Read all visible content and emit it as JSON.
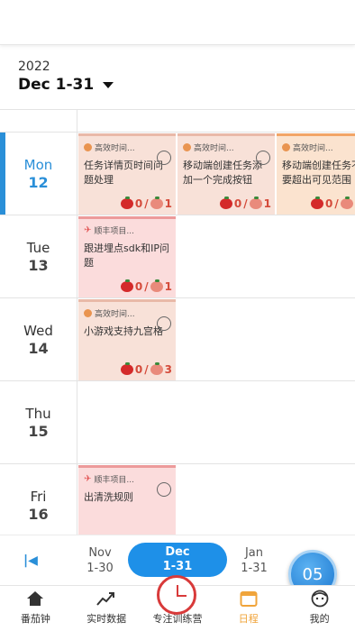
{
  "header": {
    "year": "2022",
    "range": "Dec 1-31"
  },
  "days": [
    {
      "name": "Mon",
      "num": "12",
      "today": true
    },
    {
      "name": "Tue",
      "num": "13"
    },
    {
      "name": "Wed",
      "num": "14"
    },
    {
      "name": "Thu",
      "num": "15"
    },
    {
      "name": "Fri",
      "num": "16"
    }
  ],
  "tasks": {
    "mon_1": {
      "tag": "高效时间...",
      "title": "任务详情页时间问题处理",
      "done": "0",
      "total": "1"
    },
    "mon_2": {
      "tag": "高效时间...",
      "title": "移动端创建任务添加一个完成按钮",
      "done": "0",
      "total": "1"
    },
    "mon_3": {
      "tag": "高效时间...",
      "title": "移动端创建任务不要超出可见范围",
      "done": "0",
      "total": ""
    },
    "tue_1": {
      "tag": "顺丰项目...",
      "title": "跟进埋点sdk和IP问题",
      "done": "0",
      "total": "1"
    },
    "wed_1": {
      "tag": "高效时间...",
      "title": "小游戏支持九宫格",
      "done": "0",
      "total": "3"
    },
    "fri_1": {
      "tag": "顺丰项目...",
      "title": "出清洗规则",
      "done": "",
      "total": ""
    }
  },
  "months": {
    "prev": {
      "name": "Nov",
      "range": "1-30"
    },
    "current": {
      "name": "Dec",
      "range": "1-31"
    },
    "next": {
      "name": "Jan",
      "range": "1-31"
    }
  },
  "fab_label": "05",
  "tabs": [
    "番茄钟",
    "实时数据",
    "专注训练营",
    "日程",
    "我的"
  ],
  "colors": {
    "accent": "#1e90e8",
    "active_tab": "#f0a43a",
    "tomato": "#d42a2a"
  }
}
